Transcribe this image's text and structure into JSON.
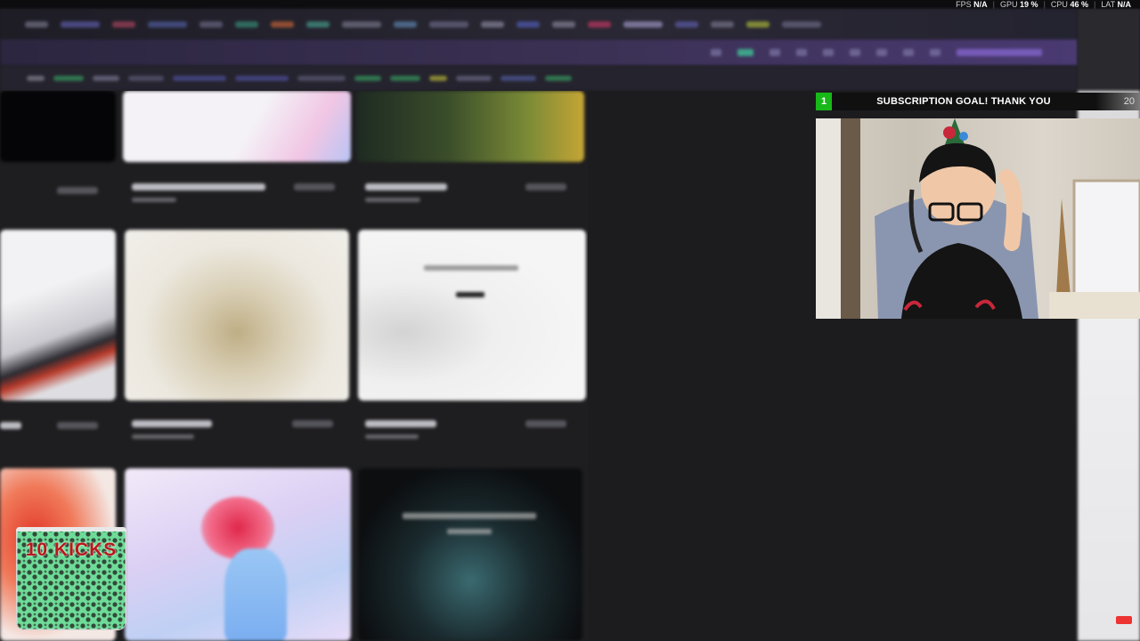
{
  "stats": {
    "fps_label": "FPS",
    "fps_value": "N/A",
    "gpu_label": "GPU",
    "gpu_value": "19 %",
    "cpu_label": "CPU",
    "cpu_value": "46 %",
    "lat_label": "LAT",
    "lat_value": "N/A"
  },
  "subscription_goal": {
    "current": "1",
    "label": "SUBSCRIPTION GOAL! THANK YOU",
    "target": "20",
    "progress_fraction": 0.05
  },
  "kicks": {
    "label": "10 KICKS"
  },
  "colors": {
    "goal_green": "#18b818",
    "browser_purple": "#3b3154",
    "gallery_bg": "#1e1e20",
    "kicks_text": "#b81818"
  }
}
